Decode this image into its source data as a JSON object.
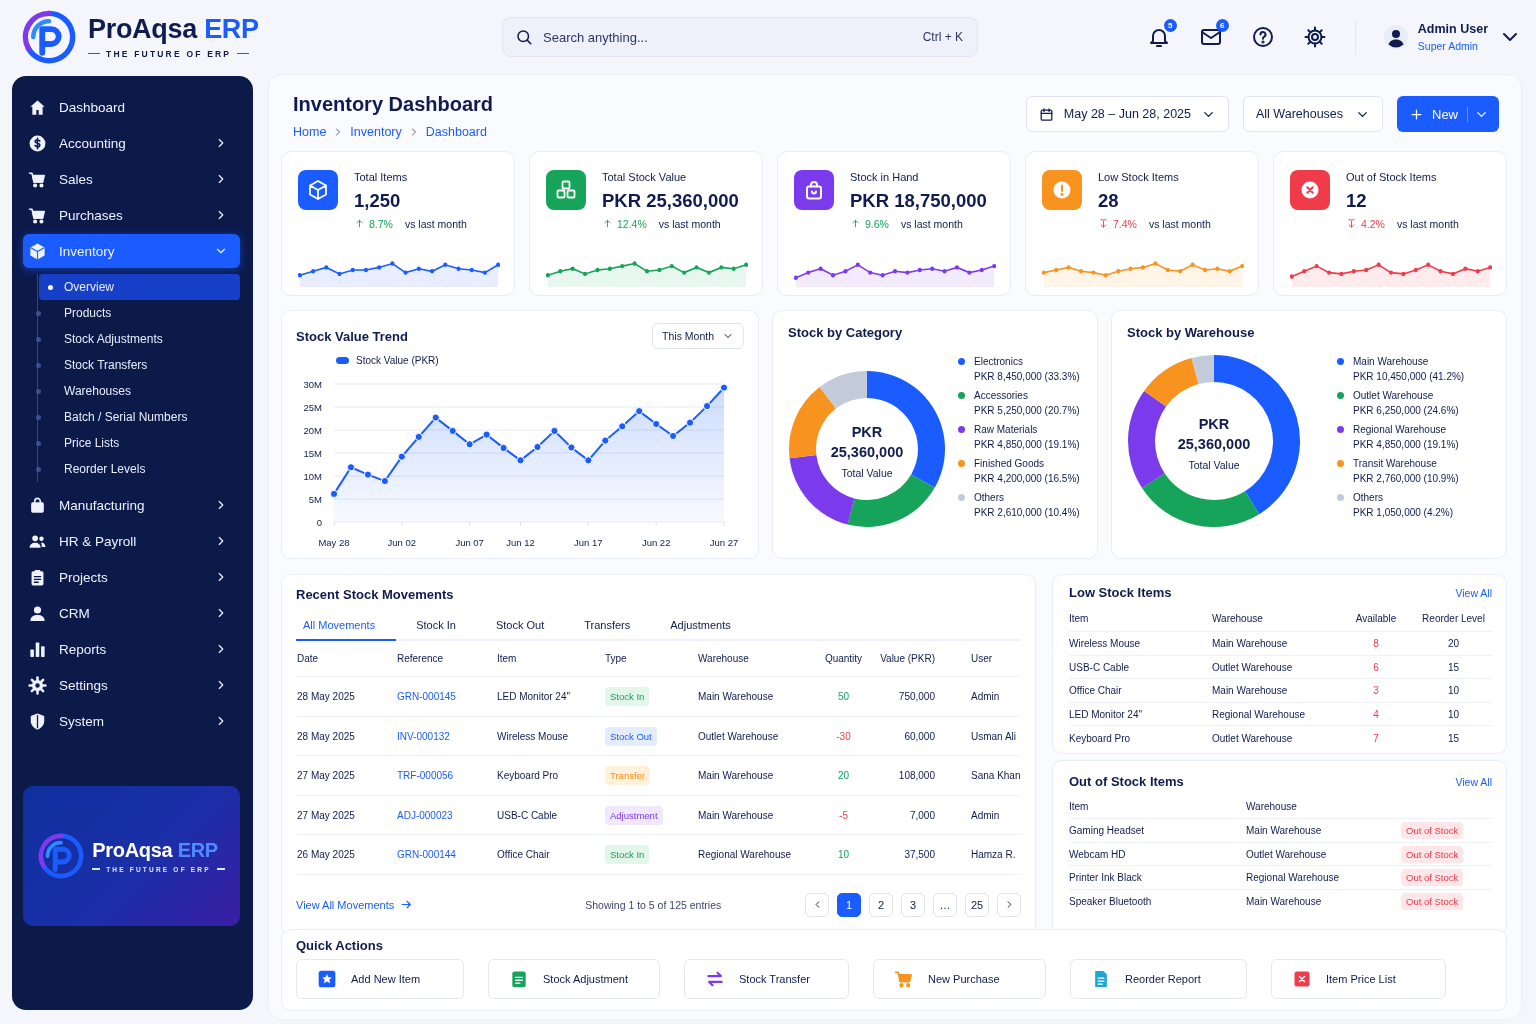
{
  "brand": {
    "name": "ProAqsa",
    "accent": "ERP",
    "tagline": "THE FUTURE OF ERP"
  },
  "search": {
    "placeholder": "Search anything...",
    "shortcut": "Ctrl + K"
  },
  "notifications": {
    "badge": "5"
  },
  "messages": {
    "badge": "6"
  },
  "user": {
    "name": "Admin User",
    "role": "Super Admin"
  },
  "sidebar": {
    "items": [
      {
        "label": "Dashboard",
        "selected": false
      },
      {
        "label": "Accounting",
        "selected": false,
        "expanded": false
      },
      {
        "label": "Sales",
        "selected": false,
        "expanded": false
      },
      {
        "label": "Purchases",
        "selected": false,
        "expanded": false
      },
      {
        "label": "Inventory",
        "selected": true,
        "expanded": true,
        "children": [
          {
            "label": "Overview",
            "selected": true
          },
          {
            "label": "Products",
            "selected": false
          },
          {
            "label": "Stock Adjustments",
            "selected": false
          },
          {
            "label": "Stock Transfers",
            "selected": false
          },
          {
            "label": "Warehouses",
            "selected": false
          },
          {
            "label": "Batch / Serial Numbers",
            "selected": false
          },
          {
            "label": "Price Lists",
            "selected": false
          },
          {
            "label": "Reorder Levels",
            "selected": false
          }
        ]
      },
      {
        "label": "Manufacturing",
        "selected": false,
        "expanded": false
      },
      {
        "label": "HR & Payroll",
        "selected": false,
        "expanded": false
      },
      {
        "label": "Projects",
        "selected": false,
        "expanded": false
      },
      {
        "label": "CRM",
        "selected": false,
        "expanded": false
      },
      {
        "label": "Reports",
        "selected": false,
        "expanded": false
      },
      {
        "label": "Settings",
        "selected": false,
        "expanded": false
      },
      {
        "label": "System",
        "selected": false,
        "expanded": false
      }
    ],
    "promo": {
      "name": "ProAqsa",
      "accent": "ERP",
      "tagline": "THE FUTURE OF ERP"
    }
  },
  "page": {
    "title": "Inventory Dashboard",
    "breadcrumb": [
      "Home",
      "Inventory",
      "Dashboard"
    ],
    "date_range": "May 28 – Jun 28, 2025",
    "warehouse_filter": "All Warehouses",
    "new_button": "New"
  },
  "kpis": [
    {
      "label": "Total Items",
      "value": "1,250",
      "change": "8.7%",
      "increase": true,
      "note": "vs last month",
      "color": "#1a5cff"
    },
    {
      "label": "Total Stock Value",
      "value": "PKR 25,360,000",
      "change": "12.4%",
      "increase": true,
      "note": "vs last month",
      "color": "#16a35a"
    },
    {
      "label": "Stock in Hand",
      "value": "PKR 18,750,000",
      "change": "9.6%",
      "increase": true,
      "note": "vs last month",
      "color": "#7c3aed"
    },
    {
      "label": "Low Stock Items",
      "value": "28",
      "change": "7.4%",
      "increase": false,
      "note": "vs last month",
      "color": "#f7931e"
    },
    {
      "label": "Out of Stock Items",
      "value": "12",
      "change": "4.2%",
      "increase": false,
      "note": "vs last month",
      "color": "#ef3b4a"
    }
  ],
  "stock_trend": {
    "title": "Stock Value Trend",
    "filter": "This Month",
    "chart_data": {
      "type": "area",
      "categories": [
        "May 28",
        null,
        null,
        null,
        "Jun 02",
        null,
        null,
        null,
        "Jun 07",
        null,
        null,
        "Jun 12",
        null,
        null,
        null,
        "Jun 17",
        null,
        null,
        null,
        "Jun 22",
        null,
        null,
        null,
        "Jun 27"
      ],
      "series": [
        {
          "name": "Stock Value (PKR)",
          "color": "#1a5cff",
          "values": [
            6100000,
            11900000,
            10300000,
            8900000,
            14200000,
            18500000,
            22700000,
            19800000,
            16900000,
            19000000,
            16100000,
            13400000,
            16300000,
            19800000,
            16200000,
            13400000,
            17700000,
            20800000,
            24100000,
            21300000,
            18700000,
            21600000,
            25200000,
            29200000
          ]
        }
      ],
      "grid": true,
      "ylim": [
        0,
        30000000
      ],
      "yticks": [
        {
          "value": 0,
          "label": "0"
        },
        {
          "value": 5000000,
          "label": "5M"
        },
        {
          "value": 10000000,
          "label": "10M"
        },
        {
          "value": 15000000,
          "label": "15M"
        },
        {
          "value": 20000000,
          "label": "20M"
        },
        {
          "value": 25000000,
          "label": "25M"
        },
        {
          "value": 30000000,
          "label": "30M"
        }
      ]
    }
  },
  "stock_by_category": {
    "title": "Stock by Category",
    "center_currency": "PKR",
    "center_value": "25,360,000",
    "center_label": "Total Value",
    "chart_data": {
      "type": "donut",
      "legend": "right",
      "categories": [
        "Electronics",
        "Accessories",
        "Raw Materials",
        "Finished Goods",
        "Others"
      ],
      "values": [
        33.3,
        20.7,
        19.1,
        16.5,
        10.4
      ],
      "value_labels": [
        "PKR 8,450,000 (33.3%)",
        "PKR 5,250,000 (20.7%)",
        "PKR 4,850,000 (19.1%)",
        "PKR 4,200,000 (16.5%)",
        "PKR 2,610,000 (10.4%)"
      ],
      "colors": [
        "#1a5cff",
        "#16a35a",
        "#7c3aed",
        "#f7931e",
        "#c3cbdb"
      ]
    }
  },
  "stock_by_warehouse": {
    "title": "Stock by Warehouse",
    "center_currency": "PKR",
    "center_value": "25,360,000",
    "center_label": "Total Value",
    "chart_data": {
      "type": "donut",
      "legend": "right",
      "categories": [
        "Main Warehouse",
        "Outlet Warehouse",
        "Regional Warehouse",
        "Transit Warehouse",
        "Others"
      ],
      "values": [
        41.2,
        24.6,
        19.1,
        10.9,
        4.2
      ],
      "value_labels": [
        "PKR 10,450,000 (41.2%)",
        "PKR 6,250,000 (24.6%)",
        "PKR 4,850,000 (19.1%)",
        "PKR 2,760,000 (10.9%)",
        "PKR 1,050,000 (4.2%)"
      ],
      "colors": [
        "#1a5cff",
        "#16a35a",
        "#7c3aed",
        "#f7931e",
        "#c3cbdb"
      ]
    }
  },
  "movements": {
    "title": "Recent Stock Movements",
    "tabs": [
      {
        "label": "All Movements",
        "selected": true
      },
      {
        "label": "Stock In",
        "selected": false
      },
      {
        "label": "Stock Out",
        "selected": false
      },
      {
        "label": "Transfers",
        "selected": false
      },
      {
        "label": "Adjustments",
        "selected": false
      }
    ],
    "columns": [
      "Date",
      "Reference",
      "Item",
      "Type",
      "Warehouse",
      "Quantity",
      "Value (PKR)",
      "User"
    ],
    "rows": [
      {
        "date": "28 May 2025",
        "reference": "GRN-000145",
        "item": "LED Monitor 24\"",
        "type": "Stock In",
        "kind": "stock_in",
        "warehouse": "Main Warehouse",
        "quantity": "50",
        "increase": true,
        "value": "750,000",
        "user": "Admin"
      },
      {
        "date": "28 May 2025",
        "reference": "INV-000132",
        "item": "Wireless Mouse",
        "type": "Stock Out",
        "kind": "stock_out",
        "warehouse": "Outlet Warehouse",
        "quantity": "-30",
        "increase": false,
        "value": "60,000",
        "user": "Usman Ali"
      },
      {
        "date": "27 May 2025",
        "reference": "TRF-000056",
        "item": "Keyboard Pro",
        "type": "Transfer",
        "kind": "transfer",
        "warehouse": "Main Warehouse",
        "quantity": "20",
        "increase": true,
        "value": "108,000",
        "user": "Sana Khan"
      },
      {
        "date": "27 May 2025",
        "reference": "ADJ-000023",
        "item": "USB-C Cable",
        "type": "Adjustment",
        "kind": "adjustment",
        "warehouse": "Main Warehouse",
        "quantity": "-5",
        "increase": false,
        "value": "7,000",
        "user": "Admin"
      },
      {
        "date": "26 May 2025",
        "reference": "GRN-000144",
        "item": "Office Chair",
        "type": "Stock In",
        "kind": "stock_in",
        "warehouse": "Regional Warehouse",
        "quantity": "10",
        "increase": true,
        "value": "37,500",
        "user": "Hamza R."
      }
    ],
    "view_all": "View All Movements",
    "showing": "Showing 1 to 5 of 125 entries",
    "pages": [
      {
        "label": "1",
        "selected": true
      },
      {
        "label": "2",
        "selected": false
      },
      {
        "label": "3",
        "selected": false
      },
      {
        "label": "…",
        "selected": false
      },
      {
        "label": "25",
        "selected": false
      }
    ]
  },
  "low_stock": {
    "title": "Low Stock Items",
    "link": "View All",
    "columns": [
      "Item",
      "Warehouse",
      "Available",
      "Reorder Level"
    ],
    "rows": [
      {
        "item": "Wireless Mouse",
        "warehouse": "Main Warehouse",
        "available": "8",
        "reorder_level": "20"
      },
      {
        "item": "USB-C Cable",
        "warehouse": "Outlet Warehouse",
        "available": "6",
        "reorder_level": "15"
      },
      {
        "item": "Office Chair",
        "warehouse": "Main Warehouse",
        "available": "3",
        "reorder_level": "10"
      },
      {
        "item": "LED Monitor 24\"",
        "warehouse": "Regional Warehouse",
        "available": "4",
        "reorder_level": "10"
      },
      {
        "item": "Keyboard Pro",
        "warehouse": "Outlet Warehouse",
        "available": "7",
        "reorder_level": "15"
      }
    ]
  },
  "out_of_stock": {
    "title": "Out of Stock Items",
    "link": "View All",
    "columns": [
      "Item",
      "Warehouse"
    ],
    "rows": [
      {
        "item": "Gaming Headset",
        "warehouse": "Main Warehouse",
        "status": "Out of Stock"
      },
      {
        "item": "Webcam HD",
        "warehouse": "Outlet Warehouse",
        "status": "Out of Stock"
      },
      {
        "item": "Printer Ink Black",
        "warehouse": "Regional Warehouse",
        "status": "Out of Stock"
      },
      {
        "item": "Speaker Bluetooth",
        "warehouse": "Main Warehouse",
        "status": "Out of Stock"
      }
    ]
  },
  "quick_actions": {
    "title": "Quick Actions",
    "items": [
      {
        "label": "Add New Item",
        "color": "#1a5cff"
      },
      {
        "label": "Stock Adjustment",
        "color": "#16a35a"
      },
      {
        "label": "Stock Transfer",
        "color": "#7c3aed"
      },
      {
        "label": "New Purchase",
        "color": "#f7931e"
      },
      {
        "label": "Reorder Report",
        "color": "#1aa6d6"
      },
      {
        "label": "Item Price List",
        "color": "#ef3b4a"
      }
    ]
  }
}
